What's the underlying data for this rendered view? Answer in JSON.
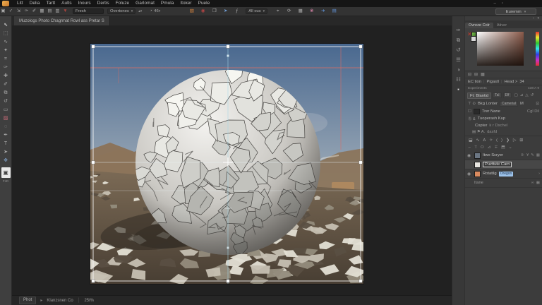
{
  "menu_bar": {
    "items": [
      "Litt",
      "Delia",
      "Tartt",
      "Aults",
      "Inours",
      "Dertis",
      "Foluze",
      "Garlomat",
      "Pmula",
      "Itoker",
      "Puele"
    ],
    "window_controls": [
      "–",
      "▫"
    ]
  },
  "options_bar": {
    "left_icons": [
      {
        "name": "tool-preset-icon",
        "glyph": "▣"
      },
      {
        "name": "checkmark-icon",
        "glyph": "✓"
      },
      {
        "name": "transform-arrow-icon",
        "glyph": "⇲"
      },
      {
        "name": "eyedropper-icon",
        "glyph": "✑"
      },
      {
        "name": "brush-icon",
        "glyph": "✐"
      },
      {
        "name": "pattern-grid-icon",
        "glyph": "▦"
      },
      {
        "name": "folder-icon",
        "glyph": "▤"
      },
      {
        "name": "folder-alt-icon",
        "glyph": "▥"
      },
      {
        "name": "red-tag-icon",
        "glyph": "▼",
        "color": "#a8433d"
      }
    ],
    "field_value": "Fresh",
    "dropdown_value": "Overtones",
    "opacity_icon": "◔",
    "opacity_value": "46",
    "mid_icons": [
      {
        "name": "orange-panel-icon",
        "glyph": "▧",
        "color": "#d9853f"
      },
      {
        "name": "sync-red-icon",
        "glyph": "◉",
        "color": "#b04444"
      },
      {
        "name": "workspace-window-icon",
        "glyph": "❒",
        "color": "#b5b5b5"
      },
      {
        "name": "blue-cursor-icon",
        "glyph": "➤",
        "color": "#6f9bd1"
      },
      {
        "name": "fx-icon",
        "glyph": "ƒ",
        "color": "#b5b5b5"
      }
    ],
    "mode_dropdown": "All ous",
    "right_icons": [
      {
        "name": "precise-cursor-icon",
        "glyph": "⌖",
        "color": "#a8a8a8"
      },
      {
        "name": "rotate-view-icon",
        "glyph": "⟳",
        "color": "#a8a8a8"
      },
      {
        "name": "grid-view-icon",
        "glyph": "▦",
        "color": "#a8a8a8"
      },
      {
        "name": "flower-icon",
        "glyph": "❀",
        "color": "#c77b9b"
      },
      {
        "name": "arrow-blue-icon",
        "glyph": "➜",
        "color": "#5f8fd1"
      },
      {
        "name": "doc-blue-icon",
        "glyph": "▤",
        "color": "#5f8fd1"
      }
    ],
    "workspace_dropdown": "Euremm"
  },
  "document_tab": {
    "title": "Muzologs Photo Chagrmat Rowl ass Pretar S"
  },
  "left_toolbar": {
    "tools": [
      {
        "name": "move-tool",
        "glyph": "⬉"
      },
      {
        "name": "marquee-tool",
        "glyph": "⬚"
      },
      {
        "name": "lasso-tool",
        "glyph": "∿"
      },
      {
        "name": "wand-tool",
        "glyph": "✦"
      },
      {
        "name": "crop-tool",
        "glyph": "⌗"
      },
      {
        "name": "eyedropper-tool",
        "glyph": "✑"
      },
      {
        "name": "heal-tool",
        "glyph": "✚"
      },
      {
        "name": "brush-tool",
        "glyph": "✐"
      },
      {
        "name": "stamp-tool",
        "glyph": "⧉"
      },
      {
        "name": "history-brush-tool",
        "glyph": "↺"
      },
      {
        "name": "eraser-tool",
        "glyph": "▭"
      },
      {
        "name": "gradient-tool",
        "glyph": "▨",
        "color": "#c96c79"
      },
      {
        "name": "blur-tool",
        "glyph": "◌"
      },
      {
        "name": "pen-tool",
        "glyph": "✒"
      },
      {
        "name": "type-tool",
        "glyph": "T"
      },
      {
        "name": "path-select-tool",
        "glyph": "➤"
      },
      {
        "name": "hand-tool",
        "glyph": "✥",
        "color": "#7f9fc6"
      }
    ],
    "selected_tool_glyph": "▣",
    "footer_label": "FsD"
  },
  "right_rail": {
    "icons": [
      {
        "name": "brush-panel-icon",
        "glyph": "✑"
      },
      {
        "name": "clone-source-panel-icon",
        "glyph": "⧉"
      },
      {
        "name": "history-panel-icon",
        "glyph": "↺"
      },
      {
        "name": "properties-panel-icon",
        "glyph": "☰"
      },
      {
        "name": "adjustments-panel-icon",
        "glyph": "◑"
      },
      {
        "name": "channels-panel-icon",
        "glyph": "☷"
      },
      {
        "name": "swatch-panel-icon",
        "glyph": "▪",
        "color": "#e0e0e0"
      }
    ]
  },
  "color_panel": {
    "tab_active": "Ovreze Colr",
    "tab_inactive": "Ativer",
    "fg_mark": "✕"
  },
  "layers_panel": {
    "top_icons": [
      "⊟",
      "⊞",
      "▦"
    ],
    "tabs": [
      "EC tion",
      "Pigastl",
      "Head >",
      "34"
    ],
    "meta_left": "Experiments",
    "meta_right": "438 A 9",
    "blend_label": "Ft:",
    "blend_value": "Blantid",
    "blend_buttons": [
      "Tal",
      "Eff"
    ],
    "blend_icons": [
      "▢",
      "⊿",
      "△",
      "↺"
    ],
    "lock_row": {
      "icons": "⊤ ⊙",
      "left": "Bkg Lonter",
      "mid": "Camerial",
      "right": "M"
    },
    "row1": {
      "name": "Trer Nane",
      "right": "Cgl Dil"
    },
    "row2": {
      "prefix": "Ⓢ &",
      "name": "Tuoperash Kup"
    },
    "row3": {
      "name": "Copter",
      "right": "k r Dschel"
    },
    "row4": {
      "icons": "▤ ⚑ A.",
      "name": "dasfd"
    },
    "glyph_row1": [
      "⬓",
      "∿",
      "Δ",
      "✧",
      "(",
      ")",
      "❯",
      "▷",
      "⊞"
    ],
    "glyph_row2": [
      "⌐",
      "T",
      "O",
      "⊿",
      "∓",
      "⬒",
      "⌄"
    ],
    "layers": [
      {
        "name": "Itwo Scryer",
        "thumb": "#6b7683",
        "eye": true,
        "right_icons": [
          "⊪",
          "¥",
          "✎",
          "▦"
        ]
      },
      {
        "name": "Puzttute Carn",
        "thumb": "#e8e6e1",
        "eye": false,
        "selected": true,
        "right_icons": []
      },
      {
        "name": "Rotatilg",
        "thumb": "#d98a5f",
        "eye": true,
        "badge": "Oregon",
        "right_icons": [
          "›"
        ]
      },
      {
        "name": "Itane",
        "thumb": "",
        "eye": false,
        "dim": true,
        "right_icons": [
          "∞",
          "▦"
        ]
      }
    ]
  },
  "status_bar": {
    "doc_label": "Phot",
    "flag_icon": "▸",
    "info": "Klanzsnen Co",
    "separator": "│",
    "zoom": "25t%"
  },
  "canvas": {
    "colors": {
      "sky_top": "#49688f",
      "sky_horizon": "#a9b4bd",
      "mountain": "#8b7257",
      "mountain_far": "#a5906f",
      "ground_light": "#7b6a55",
      "ground_dark": "#483e33",
      "tile_light": "#e3dfd4",
      "tile_mid": "#c6c0b2",
      "tile_dark": "#948c7c",
      "tile_gap": "#5a4f42",
      "sphere_hi": "#f4f3f0",
      "sphere_mid": "#cbc9c4",
      "sphere_low": "#807d78",
      "crack": "#454340",
      "shadow": "#2b251f",
      "guide_red": "#e06c63",
      "guide_cyan": "#a5d8e8",
      "selection": "#f5f5f5"
    }
  }
}
